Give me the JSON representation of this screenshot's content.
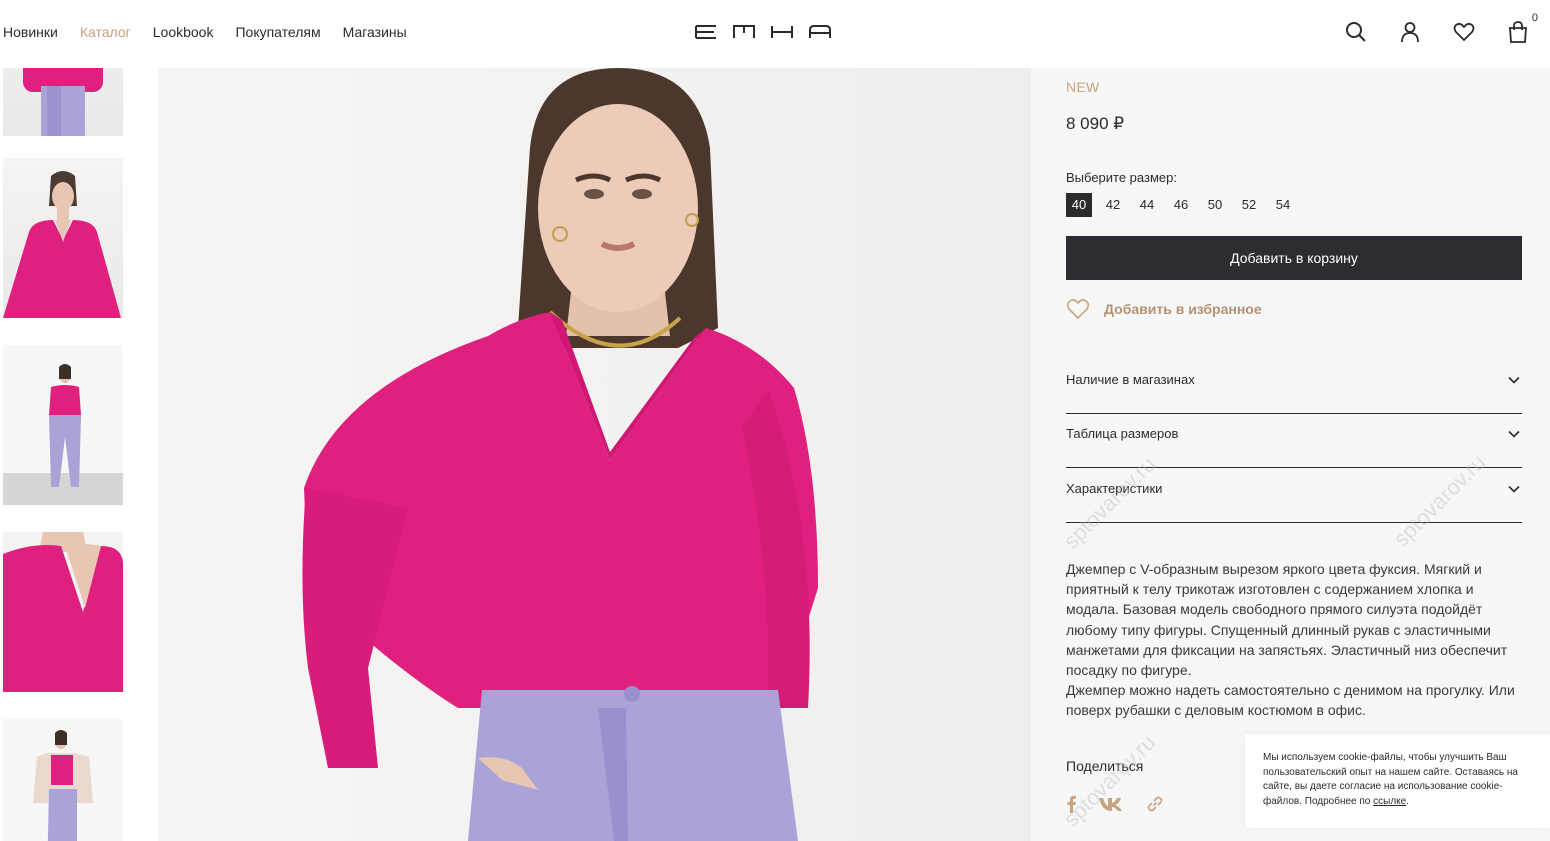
{
  "header": {
    "nav": [
      {
        "label": "Новинки",
        "active": false
      },
      {
        "label": "Каталог",
        "active": true
      },
      {
        "label": "Lookbook",
        "active": false
      },
      {
        "label": "Покупателям",
        "active": false
      },
      {
        "label": "Магазины",
        "active": false
      }
    ],
    "logo_text": "EMKA",
    "cart_count": "0",
    "icons": [
      "search-icon",
      "user-icon",
      "heart-icon",
      "bag-icon"
    ]
  },
  "product": {
    "badge": "NEW",
    "price": "8 090 ₽",
    "size_label": "Выберите размер:",
    "sizes": [
      "40",
      "42",
      "44",
      "46",
      "50",
      "52",
      "54"
    ],
    "selected_size": "40",
    "add_to_cart": "Добавить в корзину",
    "add_to_favorites": "Добавить в избранное",
    "accordions": [
      "Наличие в магазинах",
      "Таблица размеров",
      "Характеристики"
    ],
    "description": [
      "Джемпер с V-образным вырезом яркого цвета фуксия. Мягкий и приятный к телу трикотаж изготовлен с содержанием хлопка и модала. Базовая модель свободного прямого силуэта подойдёт любому типу фигуры. Спущенный длинный рукав с эластичными манжетами для фиксации на запястьях. Эластичный низ обеспечит посадку по фигуре.",
      "Джемпер можно надеть самостоятельно с денимом на прогулку. Или поверх рубашки с деловым костюмом в офис."
    ],
    "share_label": "Поделиться",
    "share_icons": [
      "facebook-icon",
      "vk-icon",
      "link-icon"
    ]
  },
  "cookie": {
    "text": "Мы используем cookie-файлы, чтобы улучшить Ваш пользовательский опыт на нашем сайте. Оставаясь на сайте, вы даете согласие на использование cookie-файлов. Подробнее по ",
    "link": "ссылке",
    "end": "."
  },
  "colors": {
    "accent": "#c9a27e",
    "button": "#2b2d33",
    "sweater": "#e0207f",
    "trousers": "#a9a3d8"
  },
  "watermark": "sptovarov.ru"
}
